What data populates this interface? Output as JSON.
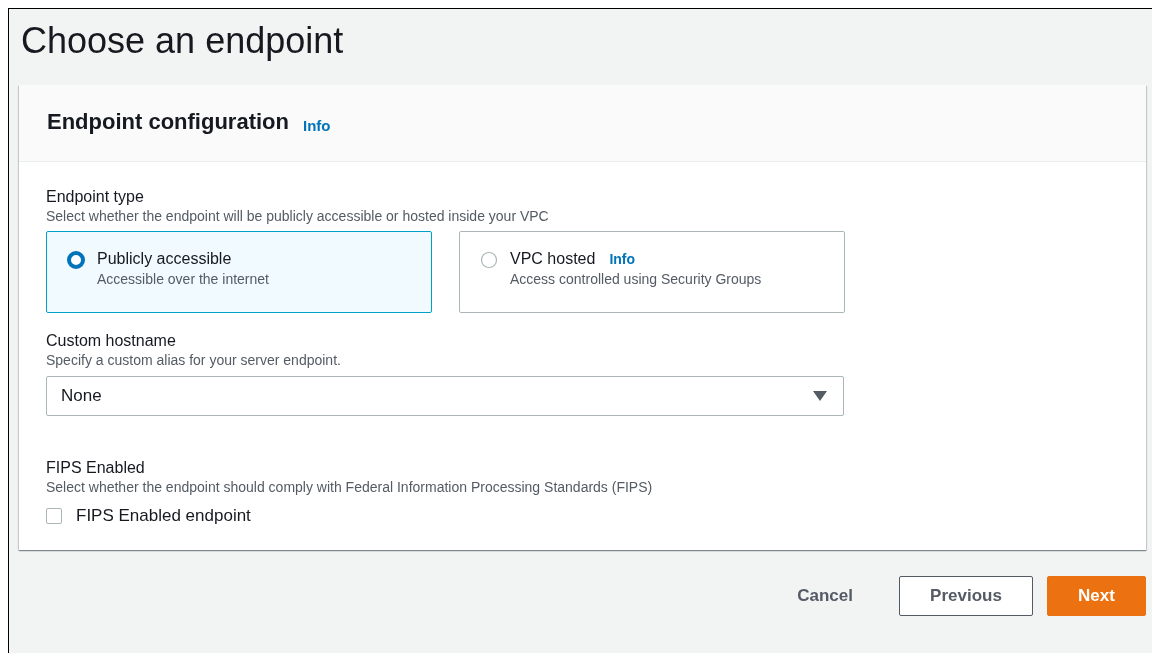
{
  "page": {
    "title": "Choose an endpoint"
  },
  "panel": {
    "title": "Endpoint configuration",
    "info_link": "Info"
  },
  "endpoint_type": {
    "label": "Endpoint type",
    "description": "Select whether the endpoint will be publicly accessible or hosted inside your VPC",
    "options": [
      {
        "label": "Publicly accessible",
        "description": "Accessible over the internet",
        "selected": true
      },
      {
        "label": "VPC hosted",
        "info_link": "Info",
        "description": "Access controlled using Security Groups",
        "selected": false
      }
    ]
  },
  "custom_hostname": {
    "label": "Custom hostname",
    "description": "Specify a custom alias for your server endpoint.",
    "value": "None"
  },
  "fips": {
    "label": "FIPS Enabled",
    "description": "Select whether the endpoint should comply with Federal Information Processing Standards (FIPS)",
    "checkbox": {
      "label": "FIPS Enabled endpoint",
      "checked": false
    }
  },
  "buttons": [
    {
      "label": "Cancel",
      "kind": "link"
    },
    {
      "label": "Previous",
      "kind": "secondary"
    },
    {
      "label": "Next",
      "kind": "primary"
    }
  ]
}
